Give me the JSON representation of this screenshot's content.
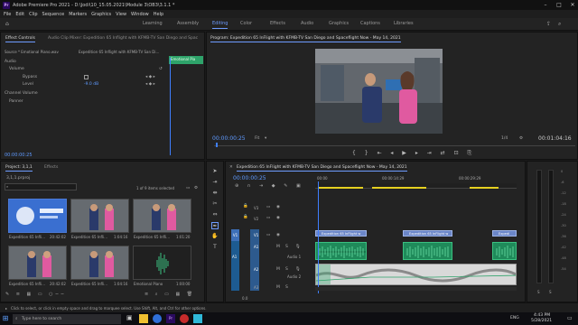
{
  "title_bar": {
    "app_icon_text": "Pr",
    "title": "Adobe Premiere Pro 2021 - D:\\Jodi\\10_15.05.2021\\Module 3\\OB3\\3.1.1 *"
  },
  "menu": [
    "File",
    "Edit",
    "Clip",
    "Sequence",
    "Markers",
    "Graphics",
    "View",
    "Window",
    "Help"
  ],
  "workspaces": {
    "items": [
      "Learning",
      "Assembly",
      "Editing",
      "Color",
      "Effects",
      "Audio",
      "Graphics",
      "Captions",
      "Libraries"
    ],
    "active": "Editing"
  },
  "effect_controls": {
    "tab_active": "Effect Controls",
    "tab_inactive": "Audio Clip Mixer: Expedition 65 Inflight with KFMB-TV San Diego and Spac",
    "source_label": "Source * Emotional Piano.wav",
    "seq_label": "Expedition 65 Inflight with KFMB-TV San Di...",
    "clip_chip": "Emotional Pia",
    "section_audio": "Audio",
    "fx_volume": "Volume",
    "bypass_label": "Bypass",
    "level_label": "Level",
    "level_value": "-9.0 dB",
    "fx_channel_volume": "Channel Volume",
    "fx_panner": "Panner",
    "timecode": "00:00:00:25"
  },
  "program_monitor": {
    "title": "Program: Expedition 65 InFlight with KFMB-TV San Diego and Spaceflight Now - May 14, 2021",
    "timecode_current": "00:00:00:25",
    "fit_label": "Fit",
    "resolution": "1/4",
    "timecode_duration": "00:01:04:16"
  },
  "project": {
    "tab_active": "Project: 3,1,1",
    "tab_inactive": "Effects",
    "file_name": "3,1,1.prproj",
    "selection_info": "1 of 9 items selected",
    "items": [
      {
        "name": "Expedition 65 Infli...",
        "duration": "20:42:02"
      },
      {
        "name": "Expedition 65 Infli...",
        "duration": "1:04:16"
      },
      {
        "name": "Expedition 65 Infli...",
        "duration": "1:01:20"
      },
      {
        "name": "Expedition 65 Infli...",
        "duration": "20:42:02"
      },
      {
        "name": "Expedition 65 Infli...",
        "duration": "1:04:16"
      },
      {
        "name": "Emotional Piano",
        "duration": "1:00:00"
      }
    ]
  },
  "timeline": {
    "sequence_title": "Expedition 65 InFlight with KFMB-TV San Diego and Spaceflight Now - May 14, 2021",
    "timecode": "00:00:00:25",
    "ruler": [
      "00:00",
      "00:00:14:29",
      "00:00:29:29"
    ],
    "tracks": [
      "V3",
      "V2",
      "V1",
      "A1",
      "A2",
      "A3"
    ],
    "source_patch": [
      "V1",
      "A1"
    ],
    "track_label_audio1": "Audio 1",
    "track_label_audio2": "Audio 2",
    "clip_v1": [
      "Expedition 65 InFlight w",
      "Expedition 65 InFlight w",
      "Expedi"
    ],
    "master_label": "0.0"
  },
  "meters": {
    "ticks": [
      "0",
      "-6",
      "-12",
      "-18",
      "-24",
      "-30",
      "-36",
      "-42",
      "-48",
      "-54"
    ],
    "solo_labels": [
      "S",
      "S"
    ]
  },
  "status_bar": {
    "hint": "Click to select, or click in empty space and drag to marquee select. Use Shift, Alt, and Ctrl for other options."
  },
  "taskbar": {
    "search": "Type here to search",
    "lang": "ENG",
    "time": "4:43 PM",
    "date": "5/28/2021"
  },
  "colors": {
    "accent_blue": "#5f9aff",
    "audio_green": "#1f8a5a",
    "video_blue": "#6b86c8",
    "playhead_blue": "#3f7fff"
  }
}
